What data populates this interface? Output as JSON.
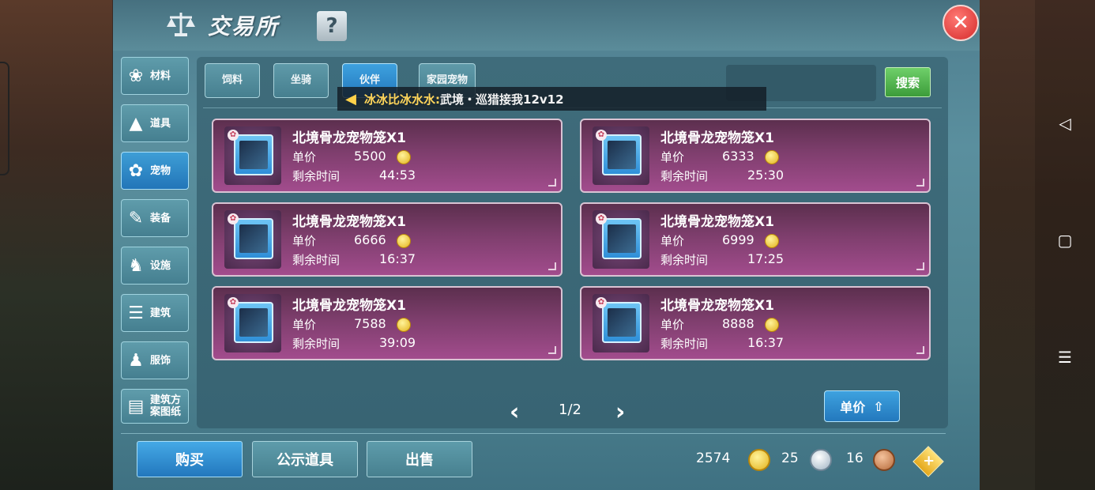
{
  "window": {
    "title": "交易所",
    "help_label": "?",
    "close_label": "✕"
  },
  "sidebar": {
    "items": [
      {
        "label": "材料",
        "icon": "materials-icon",
        "active": false
      },
      {
        "label": "道具",
        "icon": "flask-icon",
        "active": false
      },
      {
        "label": "宠物",
        "icon": "paw-icon",
        "active": true
      },
      {
        "label": "装备",
        "icon": "equipment-icon",
        "active": false
      },
      {
        "label": "设施",
        "icon": "facility-icon",
        "active": false
      },
      {
        "label": "建筑",
        "icon": "building-icon",
        "active": false
      },
      {
        "label": "服饰",
        "icon": "clothing-icon",
        "active": false
      },
      {
        "label": "建筑方案图纸",
        "icon": "blueprint-icon",
        "active": false
      }
    ]
  },
  "tabs": [
    {
      "label": "饲料",
      "active": false
    },
    {
      "label": "坐骑",
      "active": false
    },
    {
      "label": "伙伴",
      "active": true
    },
    {
      "label": "家园宠物",
      "active": false
    }
  ],
  "search": {
    "button_label": "搜索",
    "value": ""
  },
  "broadcast": {
    "name": "冰冰比冰水水:",
    "message": "武境・巡猎接我12v12"
  },
  "listings": [
    {
      "name": "北境骨龙宠物笼X1",
      "price_label": "单价",
      "price": "5500",
      "time_label": "剩余时间",
      "time": "44:53"
    },
    {
      "name": "北境骨龙宠物笼X1",
      "price_label": "单价",
      "price": "6333",
      "time_label": "剩余时间",
      "time": "25:30"
    },
    {
      "name": "北境骨龙宠物笼X1",
      "price_label": "单价",
      "price": "6666",
      "time_label": "剩余时间",
      "time": "16:37"
    },
    {
      "name": "北境骨龙宠物笼X1",
      "price_label": "单价",
      "price": "6999",
      "time_label": "剩余时间",
      "time": "17:25"
    },
    {
      "name": "北境骨龙宠物笼X1",
      "price_label": "单价",
      "price": "7588",
      "time_label": "剩余时间",
      "time": "39:09"
    },
    {
      "name": "北境骨龙宠物笼X1",
      "price_label": "单价",
      "price": "8888",
      "time_label": "剩余时间",
      "time": "16:37"
    }
  ],
  "pager": {
    "text": "1/2"
  },
  "sort": {
    "label": "单价"
  },
  "bottom_buttons": {
    "buy": "购买",
    "public": "公示道具",
    "sell": "出售"
  },
  "currency": {
    "gold": "2574",
    "silver": "25",
    "bronze": "16"
  },
  "colors": {
    "accent_blue": "#2378bd",
    "card_purple": "#7e3e6d",
    "search_green": "#3c9c3a",
    "close_red": "#d52a2a"
  }
}
